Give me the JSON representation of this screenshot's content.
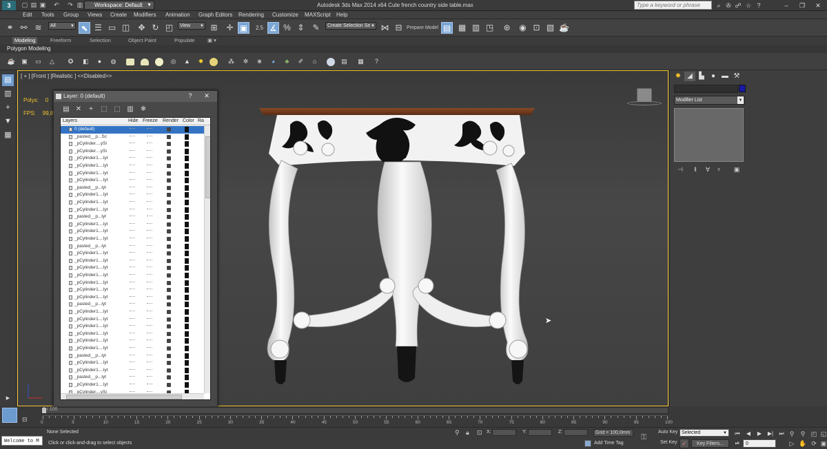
{
  "titlebar": {
    "app_icon": "3ds-max-logo",
    "workspace": "Workspace: Default",
    "title": "Autodesk 3ds Max  2014 x64     Cute french country side table.max",
    "search_placeholder": "Type a keyword or phrase"
  },
  "menu": [
    "Edit",
    "Tools",
    "Group",
    "Views",
    "Create",
    "Modifiers",
    "Animation",
    "Graph Editors",
    "Rendering",
    "Customize",
    "MAXScript",
    "Help"
  ],
  "toolbar": {
    "selection_filter": "All",
    "ref_coord": "View",
    "named_sets": "Create Selection Se",
    "snap_value": "2.5",
    "prepare_model": "Prepare Model"
  },
  "ribbon": {
    "tabs": [
      "Modeling",
      "Freeform",
      "Selection",
      "Object Paint",
      "Populate"
    ],
    "active_tab": "Modeling",
    "sub": "Polygon Modeling"
  },
  "viewport": {
    "label": "[ + ] [Front ] [Realistic ]  <<Disabled>>",
    "polys_label": "Polys:",
    "polys_value": "0",
    "fps_label": "FPS:",
    "fps_value": "99,8"
  },
  "layer_dialog": {
    "title": "Layer: 0 (default)",
    "help": "?",
    "close": "✕",
    "columns": [
      "Layers",
      "Hide",
      "Freeze",
      "Render",
      "Color",
      "Ra"
    ],
    "rows": [
      "0 (default)",
      "_pasted__p...Sc",
      "_pCylinder....ySi",
      "_pCylinder....ySi",
      "_pCylinder1....lyt",
      "_pCylinder1....lyt",
      "_pCylinder1....lyt",
      "_pCylinder1....lyt",
      "_pasted__p...lyt",
      "_pCylinder1....lyt",
      "_pCylinder1....lyt",
      "_pCylinder1....lyt",
      "_pasted__p...lyt",
      "_pCylinder1....lyt",
      "_pCylinder1....lyt",
      "_pCylinder1....lyt",
      "_pasted__p...lyt",
      "_pCylinder1....lyt",
      "_pCylinder1....lyt",
      "_pCylinder1....lyt",
      "_pCylinder1....lyt",
      "_pCylinder1....lyt",
      "_pCylinder1....lyt",
      "_pCylinder1....lyt",
      "_pasted__p...lyt",
      "_pCylinder1....lyt",
      "_pCylinder1....lyt",
      "_pCylinder1....lyt",
      "_pCylinder1....lyt",
      "_pCylinder1....lyt",
      "_pCylinder1....lyt",
      "_pasted__p...lyt",
      "_pCylinder1....lyt",
      "_pCylinder1....lyt",
      "_pasted__p...lyt",
      "_pCylinder1....lyt",
      "_pCylinder....ySi"
    ]
  },
  "command_panel": {
    "modifier_list": "Modifier List",
    "object_color": "#1a1aa5"
  },
  "timeline": {
    "frame_display": "0 / 100",
    "ticks": [
      "0",
      "5",
      "10",
      "15",
      "20",
      "25",
      "30",
      "35",
      "40",
      "45",
      "50",
      "55",
      "60",
      "65",
      "70",
      "75",
      "80",
      "85",
      "90",
      "95",
      "100"
    ]
  },
  "status": {
    "maxscript": "Welcome to M",
    "selection": "None Selected",
    "prompt": "Click or click-and-drag to select objects",
    "x_label": "X:",
    "y_label": "Y:",
    "z_label": "Z:",
    "grid": "Grid = 100,0mm",
    "add_time_tag": "Add Time Tag",
    "auto_key": "Auto Key",
    "set_key": "Set Key",
    "key_mode": "Selected",
    "key_filters": "Key Filters...",
    "frame": "0"
  },
  "colors": {
    "viewport_border": "#f2c22a",
    "stats_text": "#f2c22a",
    "selected_row": "#3373c4",
    "active_tool": "#7aa6d6"
  }
}
